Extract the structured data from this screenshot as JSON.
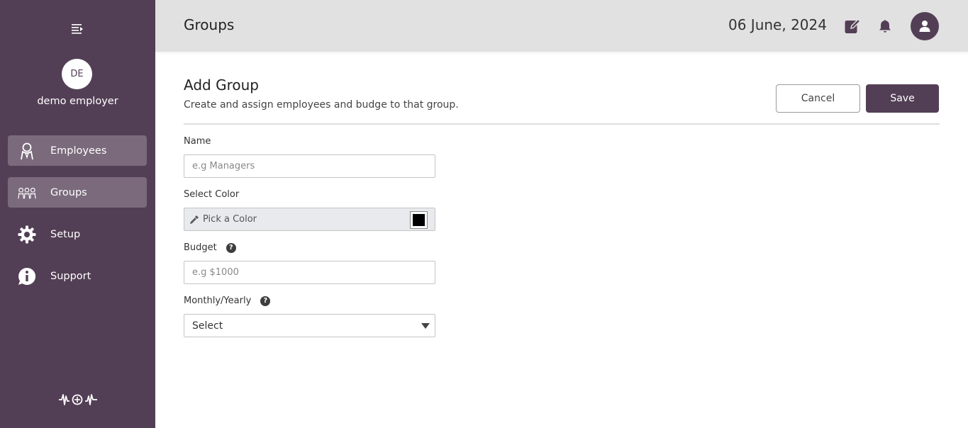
{
  "sidebar": {
    "menu_icon": "menu-collapse-icon",
    "user_initials": "DE",
    "user_name": "demo employer",
    "items": [
      {
        "label": "Employees",
        "icon": "employee-icon",
        "active": true
      },
      {
        "label": "Groups",
        "icon": "groups-icon",
        "active": true
      },
      {
        "label": "Setup",
        "icon": "gear-icon",
        "active": false
      },
      {
        "label": "Support",
        "icon": "info-icon",
        "active": false
      }
    ],
    "logo_icon": "wow-logo-icon"
  },
  "header": {
    "title": "Groups",
    "date": "06 June, 2024",
    "icons": [
      "edit-icon",
      "bell-icon",
      "user-icon"
    ]
  },
  "main": {
    "title": "Add Group",
    "subtitle": "Create and assign employees and budge to that group.",
    "cancel_label": "Cancel",
    "save_label": "Save",
    "fields": {
      "name": {
        "label": "Name",
        "placeholder": "e.g Managers",
        "value": ""
      },
      "color": {
        "label": "Select Color",
        "placeholder": "Pick a Color",
        "swatch_color": "#000000"
      },
      "budget": {
        "label": "Budget",
        "placeholder": "e.g $1000",
        "value": "",
        "help": "?"
      },
      "period": {
        "label": "Monthly/Yearly",
        "selected": "Select",
        "help": "?"
      }
    }
  },
  "colors": {
    "brand": "#533f55",
    "sidebar_active": "#7a6a7c",
    "header_bg": "#e1e1e1"
  }
}
